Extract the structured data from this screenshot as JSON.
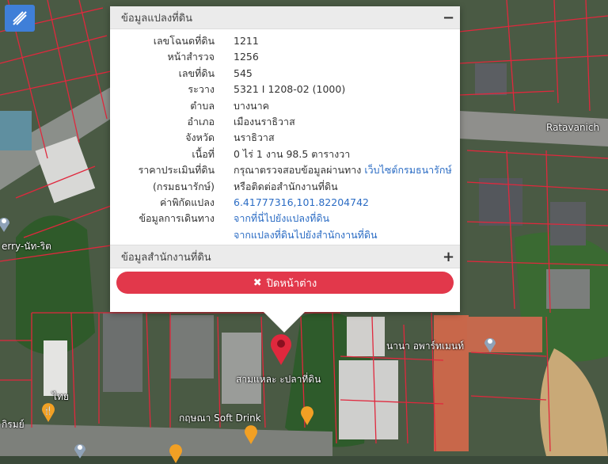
{
  "map": {
    "labels": {
      "road_ratavanich": "Ratavanich",
      "road_left": "erry-นัท-ริต",
      "apartment": "นานา อพาร์ทเมนท์",
      "marker_place": "สามแหละ ะปลาที่ดิน",
      "soft_drink": "กฤษณา Soft Drink",
      "thai": "ไทย",
      "shop_left": "กิรมย์"
    },
    "pin_color": "#e0283d",
    "tool_icon": "measure-tool-icon"
  },
  "popup": {
    "section1_title": "ข้อมูลแปลงที่ดิน",
    "section1_toggle": "−",
    "rows": [
      {
        "key": "เลขโฉนดที่ดิน",
        "value": "1211"
      },
      {
        "key": "หน้าสำรวจ",
        "value": "1256"
      },
      {
        "key": "เลขที่ดิน",
        "value": "545"
      },
      {
        "key": "ระวาง",
        "value": "5321 I 1208-02 (1000)"
      },
      {
        "key": "ตำบล",
        "value": "บางนาค"
      },
      {
        "key": "อำเภอ",
        "value": "เมืองนราธิวาส"
      },
      {
        "key": "จังหวัด",
        "value": "นราธิวาส"
      },
      {
        "key": "เนื้อที่",
        "value": "0 ไร่ 1 งาน 98.5 ตารางวา"
      }
    ],
    "price_key": "ราคาประเมินที่ดิน",
    "price_text": "กรุณาตรวจสอบข้อมูลผ่านทาง",
    "price_link": "เว็บไซต์กรมธนารักษ์",
    "treasury_key": "(กรมธนารักษ์)",
    "treasury_text": "หรือติดต่อสำนักงานที่ดิน",
    "coord_key": "ค่าพิกัดแปลง",
    "coord_value": "6.41777316,101.82204742",
    "travel_key": "ข้อมูลการเดินทาง",
    "travel_link1": "จากที่นี่ไปยังแปลงที่ดิน",
    "travel_link2": "จากแปลงที่ดินไปยังสำนักงานที่ดิน",
    "section2_title": "ข้อมูลสำนักงานที่ดิน",
    "section2_toggle": "+",
    "close_label": "ปิดหน้าต่าง"
  }
}
